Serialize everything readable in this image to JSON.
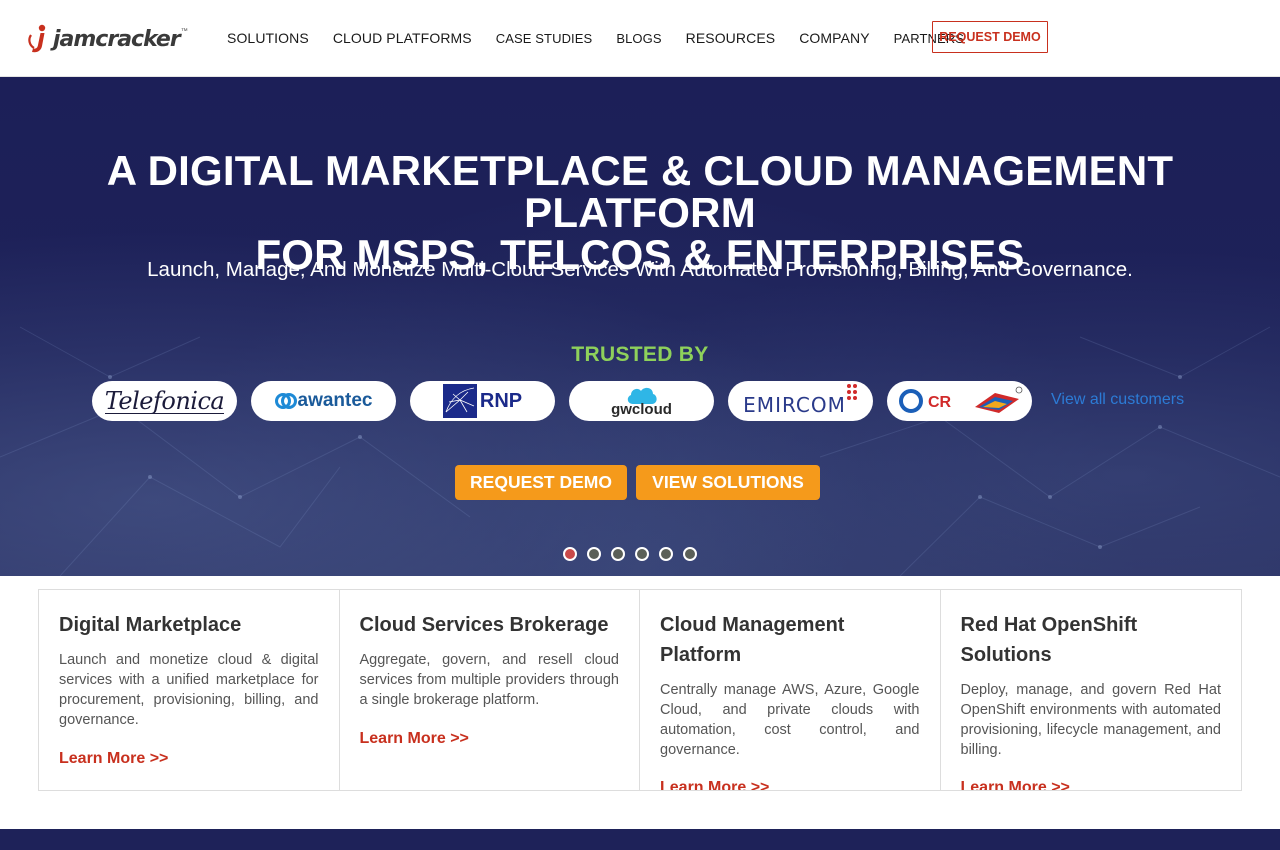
{
  "header": {
    "logo_text": "jamcracker",
    "logo_tm": "™",
    "nav": [
      "SOLUTIONS",
      "CLOUD PLATFORMS",
      "CASE STUDIES",
      "BLOGS",
      "RESOURCES",
      "COMPANY",
      "PARTNERS"
    ],
    "request_demo": "REQUEST DEMO"
  },
  "hero": {
    "title_line1": "A DIGITAL MARKETPLACE & CLOUD MANAGEMENT PLATFORM",
    "title_line2": "FOR MSPS, TELCOS & ENTERPRISES",
    "subtitle": "Launch, Manage, And Monetize Multi-Cloud Services With Automated Provisioning, Billing, And Governance.",
    "trusted_by": "TRUSTED BY",
    "customers": [
      "Telefonica",
      "awantec",
      "RNP",
      "gwcloud",
      "EMIRCOM",
      "CR Technologies"
    ],
    "view_all": "View all customers",
    "btn_demo": "REQUEST DEMO",
    "btn_solutions": "VIEW SOLUTIONS",
    "slides_count": 6,
    "active_slide": 1
  },
  "cards": [
    {
      "title": "Digital Marketplace",
      "text": "Launch and monetize cloud & digital services with a unified marketplace for procurement, provisioning, billing, and governance.",
      "link": "Learn More >>"
    },
    {
      "title": "Cloud Services Brokerage",
      "text": "Aggregate, govern, and resell cloud services from multiple providers through a single brokerage platform.",
      "link": "Learn More >>"
    },
    {
      "title": "Cloud Management Platform",
      "text": "Centrally manage AWS, Azure, Google Cloud, and private clouds with automation, cost control, and governance.",
      "link": "Learn More >>"
    },
    {
      "title": "Red Hat OpenShift Solutions",
      "text": "Deploy, manage, and govern Red Hat OpenShift environments with automated provisioning, lifecycle management, and billing.",
      "link": "Learn More >>"
    }
  ],
  "colors": {
    "brand_red": "#c8301e",
    "hero_navy": "#1e2259",
    "accent_orange": "#f59a1b",
    "trusted_green": "#8ed15b",
    "link_blue": "#2c7bd6"
  }
}
